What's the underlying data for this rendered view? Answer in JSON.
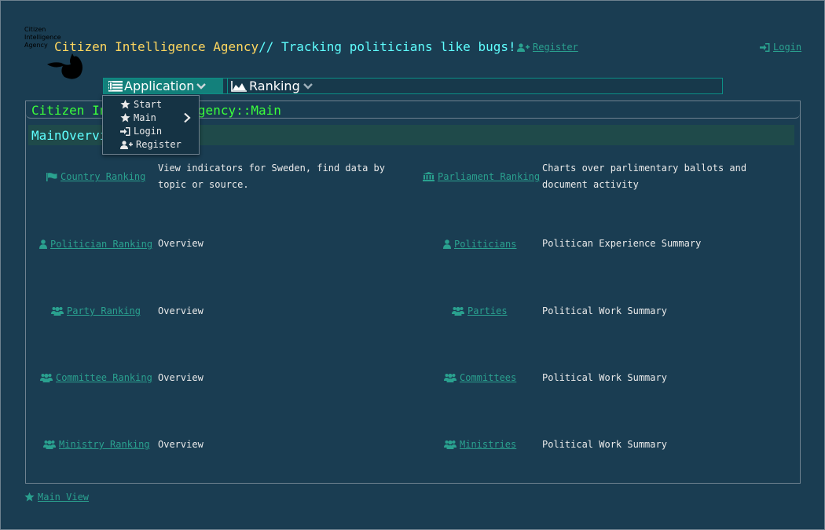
{
  "header": {
    "logo_text": "Citizen Intelligence Agency",
    "title_main": "Citizen Intelligence Agency",
    "title_tagline": "// Tracking politicians like bugs!",
    "register_label": "Register",
    "login_label": "Login"
  },
  "menubar": {
    "application_label": "Application",
    "ranking_label": "Ranking"
  },
  "dropdown": {
    "items": [
      {
        "label": "Start",
        "icon": "star-icon"
      },
      {
        "label": "Main",
        "icon": "star-icon"
      },
      {
        "label": "Login",
        "icon": "sign-in-icon"
      },
      {
        "label": "Register",
        "icon": "user-plus-icon"
      }
    ]
  },
  "main": {
    "title": "Citizen Intelligence Agency::Main",
    "overview_title": "MainOverview",
    "rows": [
      {
        "left_link": "Country Ranking",
        "left_icon": "flag-icon",
        "left_desc": "View indicators for Sweden, find data by topic or source.",
        "right_link": "Parliament Ranking",
        "right_icon": "institution-icon",
        "right_desc": "Charts over parlimentary ballots and document activity"
      },
      {
        "left_link": "Politician Ranking",
        "left_icon": "user-icon",
        "left_desc": "Overview",
        "right_link": "Politicians",
        "right_icon": "user-icon",
        "right_desc": "Politican Experience Summary"
      },
      {
        "left_link": "Party Ranking",
        "left_icon": "group-icon",
        "left_desc": "Overview",
        "right_link": "Parties",
        "right_icon": "group-icon",
        "right_desc": "Political Work Summary"
      },
      {
        "left_link": "Committee Ranking",
        "left_icon": "group-icon",
        "left_desc": "Overview",
        "right_link": "Committees",
        "right_icon": "group-icon",
        "right_desc": "Political Work Summary"
      },
      {
        "left_link": "Ministry Ranking",
        "left_icon": "group-icon",
        "left_desc": "Overview",
        "right_link": "Ministries",
        "right_icon": "group-icon",
        "right_desc": "Political Work Summary"
      }
    ]
  },
  "footer": {
    "main_view_label": "Main View"
  },
  "colors": {
    "background": "#1a3d52",
    "link": "#2aa18f",
    "title_yellow": "#ffd75f",
    "title_cyan": "#5fffff",
    "main_title_green": "#3bff3b",
    "menu_active": "#13807b"
  }
}
